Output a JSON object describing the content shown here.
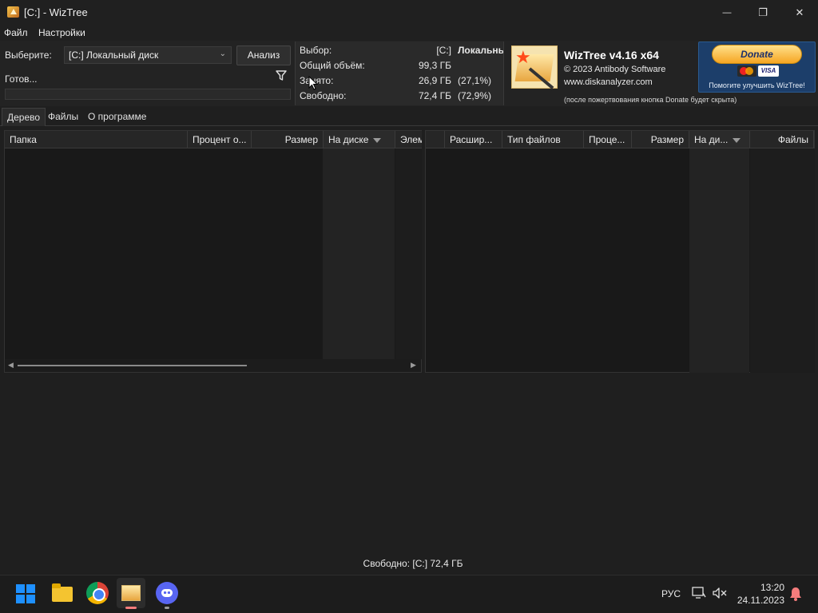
{
  "window": {
    "title": "[C:]  - WizTree",
    "minimize_glyph": "—",
    "maximize_glyph": "❐",
    "close_glyph": "✕"
  },
  "menu": {
    "file": "Файл",
    "settings": "Настройки"
  },
  "scan": {
    "select_label": "Выберите:",
    "drive_value": "[C:] Локальный диск",
    "analyze_label": "Анализ",
    "status": "Готов..."
  },
  "stats": {
    "selection_label": "Выбор:",
    "selection_value": "[C:]",
    "selection_name": "Локальный",
    "total_label": "Общий объём:",
    "total_value": "99,3 ГБ",
    "used_label": "Занято:",
    "used_value": "26,9 ГБ",
    "used_pct": "(27,1%)",
    "free_label": "Свободно:",
    "free_value": "72,4 ГБ",
    "free_pct": "(72,9%)"
  },
  "about": {
    "app_name": "WizTree v4.16 x64",
    "copyright": "© 2023 Antibody Software",
    "website": "www.diskanalyzer.com",
    "donate_note": "(после пожертвования кнопка Donate будет скрыта)"
  },
  "donate": {
    "button_label": "Donate",
    "visa_label": "VISA",
    "caption": "Помогите улучшить WizTree!"
  },
  "tabs": [
    {
      "label": "Дерево",
      "active": true
    },
    {
      "label": "Файлы",
      "active": false
    },
    {
      "label": "О программе",
      "active": false
    }
  ],
  "tree_columns": {
    "folder": "Папка",
    "percent": "Процент о...",
    "size": "Размер",
    "on_disk": "На диске",
    "items": "Элем"
  },
  "ext_columns": {
    "extension": "Расшир...",
    "file_type": "Тип файлов",
    "percent": "Проце...",
    "size": "Размер",
    "on_disk": "На ди...",
    "files": "Файлы"
  },
  "footer": {
    "free_text": "Свободно: [C:] 72,4 ГБ"
  },
  "taskbar": {
    "language": "РУС",
    "time": "13:20",
    "date": "24.11.2023"
  },
  "colors": {
    "background": "#1f1f1f",
    "panel": "#191919",
    "accent_blue": "#1e90ff",
    "donate_gold": "#f6a623"
  }
}
